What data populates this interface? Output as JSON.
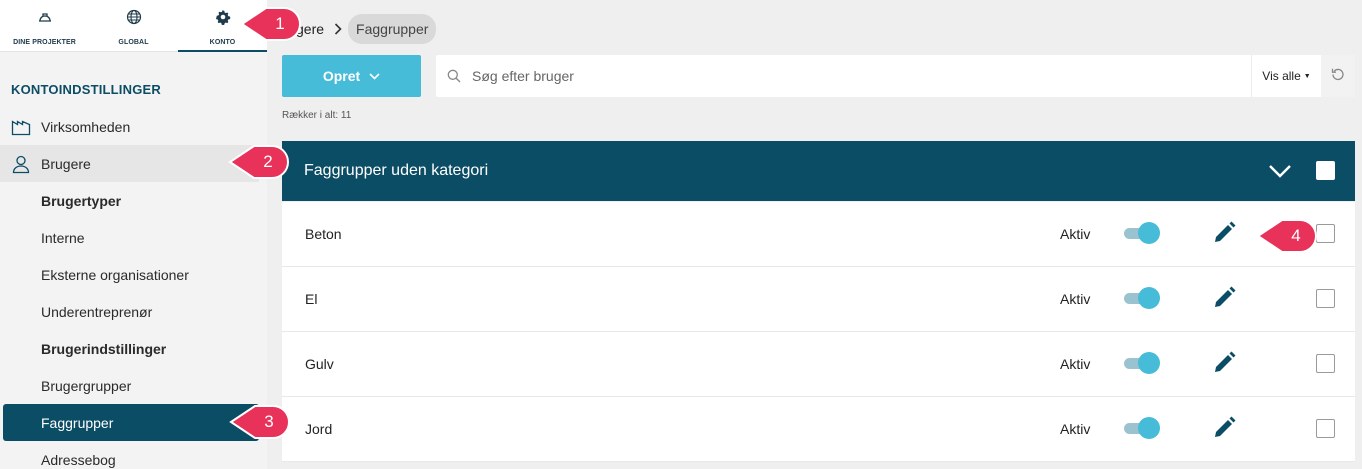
{
  "topnav": {
    "items": [
      {
        "label": "DINE PROJEKTER",
        "icon": "hard-hat-icon"
      },
      {
        "label": "GLOBAL",
        "icon": "globe-icon"
      },
      {
        "label": "KONTO",
        "icon": "gear-icon"
      }
    ]
  },
  "sidebar": {
    "section_title": "KONTOINDSTILLINGER",
    "items": [
      {
        "label": "Virksomheden",
        "icon": "factory-icon"
      },
      {
        "label": "Brugere",
        "icon": "user-icon"
      },
      {
        "label": "Brugertyper"
      },
      {
        "label": "Interne"
      },
      {
        "label": "Eksterne organisationer"
      },
      {
        "label": "Underentreprenør"
      },
      {
        "label": "Brugerindstillinger"
      },
      {
        "label": "Brugergrupper"
      },
      {
        "label": "Faggrupper"
      },
      {
        "label": "Adressebog"
      }
    ]
  },
  "breadcrumb": {
    "parent": "gere",
    "current": "Faggrupper"
  },
  "toolbar": {
    "create_label": "Opret",
    "search_placeholder": "Søg efter bruger",
    "filter_label": "Vis alle"
  },
  "row_count": "Rækker i alt: 11",
  "group": {
    "title": "Faggrupper uden kategori"
  },
  "rows": [
    {
      "name": "Beton",
      "status": "Aktiv"
    },
    {
      "name": "El",
      "status": "Aktiv"
    },
    {
      "name": "Gulv",
      "status": "Aktiv"
    },
    {
      "name": "Jord",
      "status": "Aktiv"
    }
  ],
  "markers": [
    "1",
    "2",
    "3",
    "4"
  ],
  "colors": {
    "primary": "#0c4d66",
    "accent": "#46bcd8",
    "marker": "#e8325a"
  }
}
